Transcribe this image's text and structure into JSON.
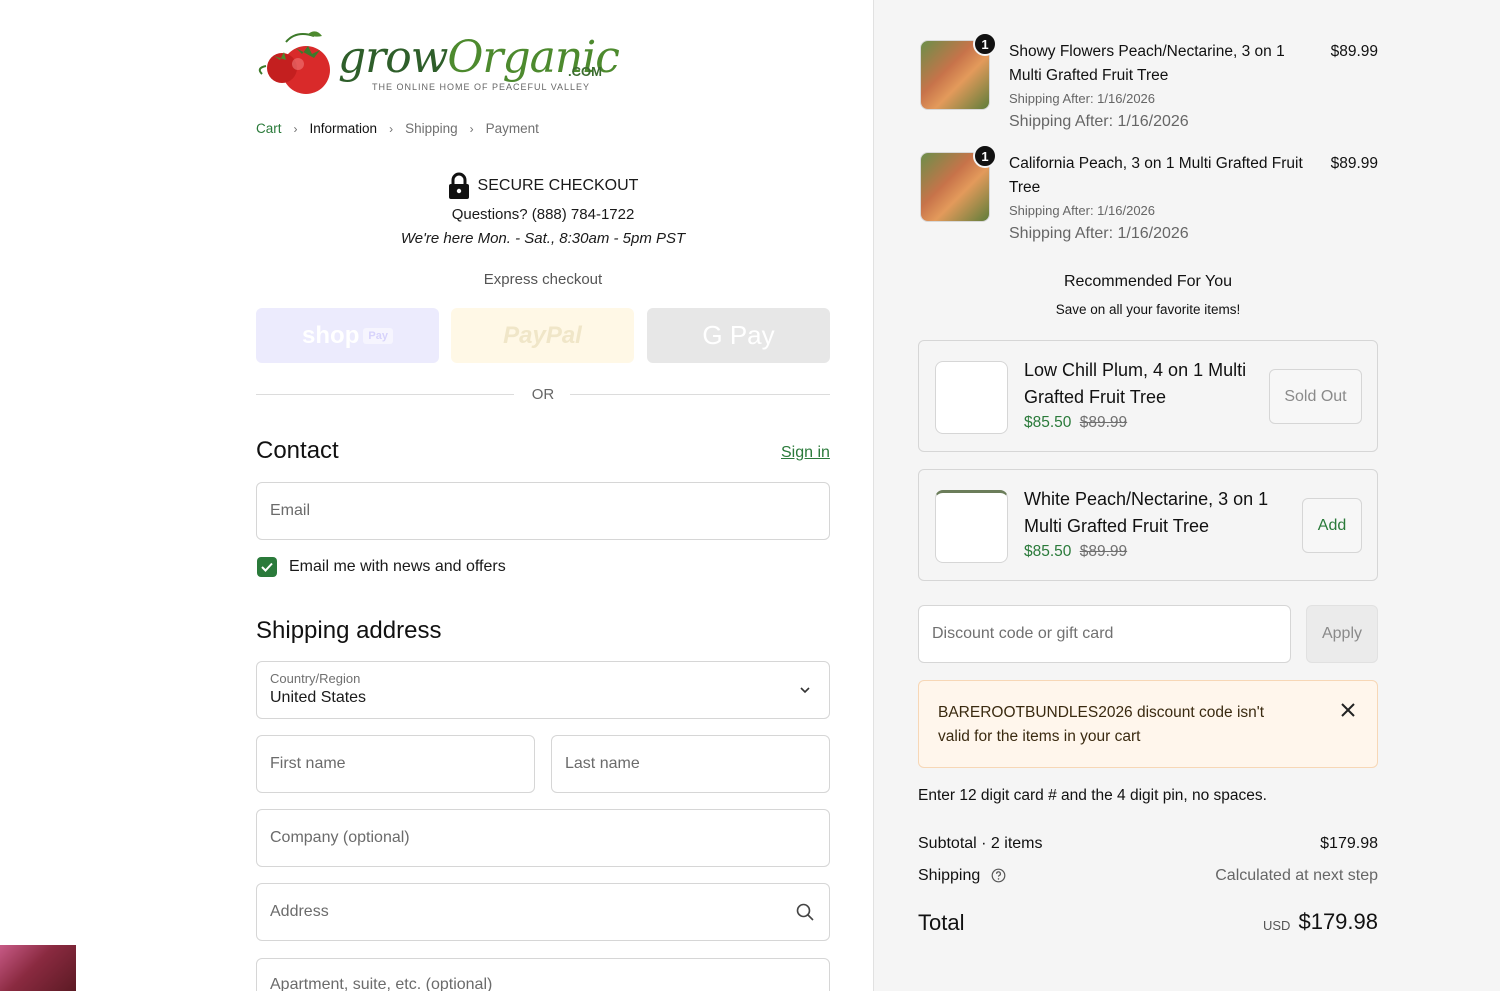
{
  "logo": {
    "brand_prefix": "grow",
    "brand_suffix": "Organic",
    "domain": ".COM",
    "tagline": "THE ONLINE HOME OF PEACEFUL VALLEY"
  },
  "breadcrumb": {
    "cart": "Cart",
    "information": "Information",
    "shipping": "Shipping",
    "payment": "Payment",
    "separator": "›"
  },
  "secure": {
    "title": "SECURE CHECKOUT",
    "questions": "Questions? (888) 784-1722",
    "hours": "We're here Mon. - Sat., 8:30am - 5pm PST"
  },
  "express": {
    "label": "Express checkout",
    "shop": "shop",
    "shop_pay": "Pay",
    "paypal": "PayPal",
    "gpay": "G Pay",
    "or": "OR"
  },
  "contact": {
    "heading": "Contact",
    "sign_in": "Sign in",
    "email_placeholder": "Email",
    "marketing_label": "Email me with news and offers",
    "marketing_checked": true
  },
  "shipping_address": {
    "heading": "Shipping address",
    "country_label": "Country/Region",
    "country_value": "United States",
    "first_name": "First name",
    "last_name": "Last name",
    "company": "Company (optional)",
    "address": "Address",
    "apartment": "Apartment, suite, etc. (optional)"
  },
  "cart_items": [
    {
      "title": "Showy Flowers Peach/Nectarine, 3 on 1 Multi Grafted Fruit Tree",
      "price": "$89.99",
      "quantity": "1",
      "ship_small": "Shipping After: 1/16/2026",
      "ship": "Shipping After: 1/16/2026"
    },
    {
      "title": "California Peach, 3 on 1 Multi Grafted Fruit Tree",
      "price": "$89.99",
      "quantity": "1",
      "ship_small": "Shipping After: 1/16/2026",
      "ship": "Shipping After: 1/16/2026"
    }
  ],
  "recommended": {
    "title": "Recommended For You",
    "subtitle": "Save on all your favorite items!",
    "items": [
      {
        "name": "Low Chill Plum, 4 on 1 Multi Grafted Fruit Tree",
        "price": "$85.50",
        "compare": "$89.99",
        "button": "Sold Out"
      },
      {
        "name": "White Peach/Nectarine, 3 on 1 Multi Grafted Fruit Tree",
        "price": "$85.50",
        "compare": "$89.99",
        "button": "Add"
      }
    ]
  },
  "discount": {
    "placeholder": "Discount code or gift card",
    "apply": "Apply",
    "error": "BAREROOTBUNDLES2026 discount code isn't valid for the items in your cart",
    "hint": "Enter 12 digit card # and the 4 digit pin, no spaces."
  },
  "summary": {
    "subtotal_label": "Subtotal · 2 items",
    "subtotal_value": "$179.98",
    "shipping_label": "Shipping",
    "shipping_value": "Calculated at next step",
    "total_label": "Total",
    "currency": "USD",
    "total_value": "$179.98"
  },
  "colors": {
    "accent_green": "#2a7a3a",
    "error_bg": "#fff6ec",
    "sidebar_bg": "#f5f5f5"
  }
}
